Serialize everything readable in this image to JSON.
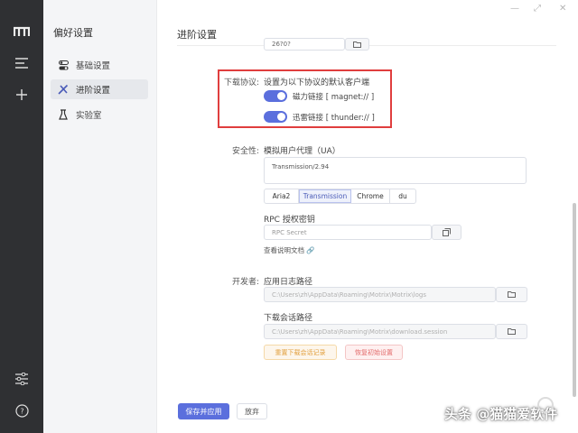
{
  "colors": {
    "accent": "#5b6fdd",
    "highlight": "#e03e3e",
    "rail": "#2f3033"
  },
  "rail": {
    "icons": [
      "logo-icon",
      "menu-icon",
      "add-icon",
      "sliders-icon",
      "help-icon"
    ]
  },
  "sidebar": {
    "title": "偏好设置",
    "items": [
      {
        "label": "基础设置",
        "icon": "toggle-icon"
      },
      {
        "label": "进阶设置",
        "icon": "tools-icon"
      },
      {
        "label": "实验室",
        "icon": "flask-icon"
      }
    ]
  },
  "main": {
    "title": "进阶设置",
    "top_input_value": "26?0?",
    "protocol": {
      "label": "下载协议:",
      "description": "设置为以下协议的默认客户端",
      "magnet": "磁力链接 [ magnet:// ]",
      "thunder": "迅雷链接 [ thunder:// ]"
    },
    "security": {
      "label": "安全性:",
      "ua_label": "模拟用户代理（UA）",
      "ua_value": "Transmission/2.94",
      "ua_tabs": [
        "Aria2",
        "Transmission",
        "Chrome",
        "du"
      ],
      "rpc_label": "RPC 授权密钥",
      "rpc_placeholder": "RPC Secret",
      "doc_link": "查看说明文档"
    },
    "developer": {
      "label": "开发者:",
      "log_label": "应用日志路径",
      "log_path": "C:\\Users\\zh\\AppData\\Roaming\\Motrix\\Motrix\\logs",
      "session_label": "下载会话路径",
      "session_path": "C:\\Users\\zh\\AppData\\Roaming\\Motrix\\download.session",
      "reset_session": "重置下载会话记录",
      "factory_reset": "恢复初始设置"
    },
    "save": "保存并应用",
    "discard": "放弃"
  },
  "watermark": "头条 @猫猫爱软件"
}
